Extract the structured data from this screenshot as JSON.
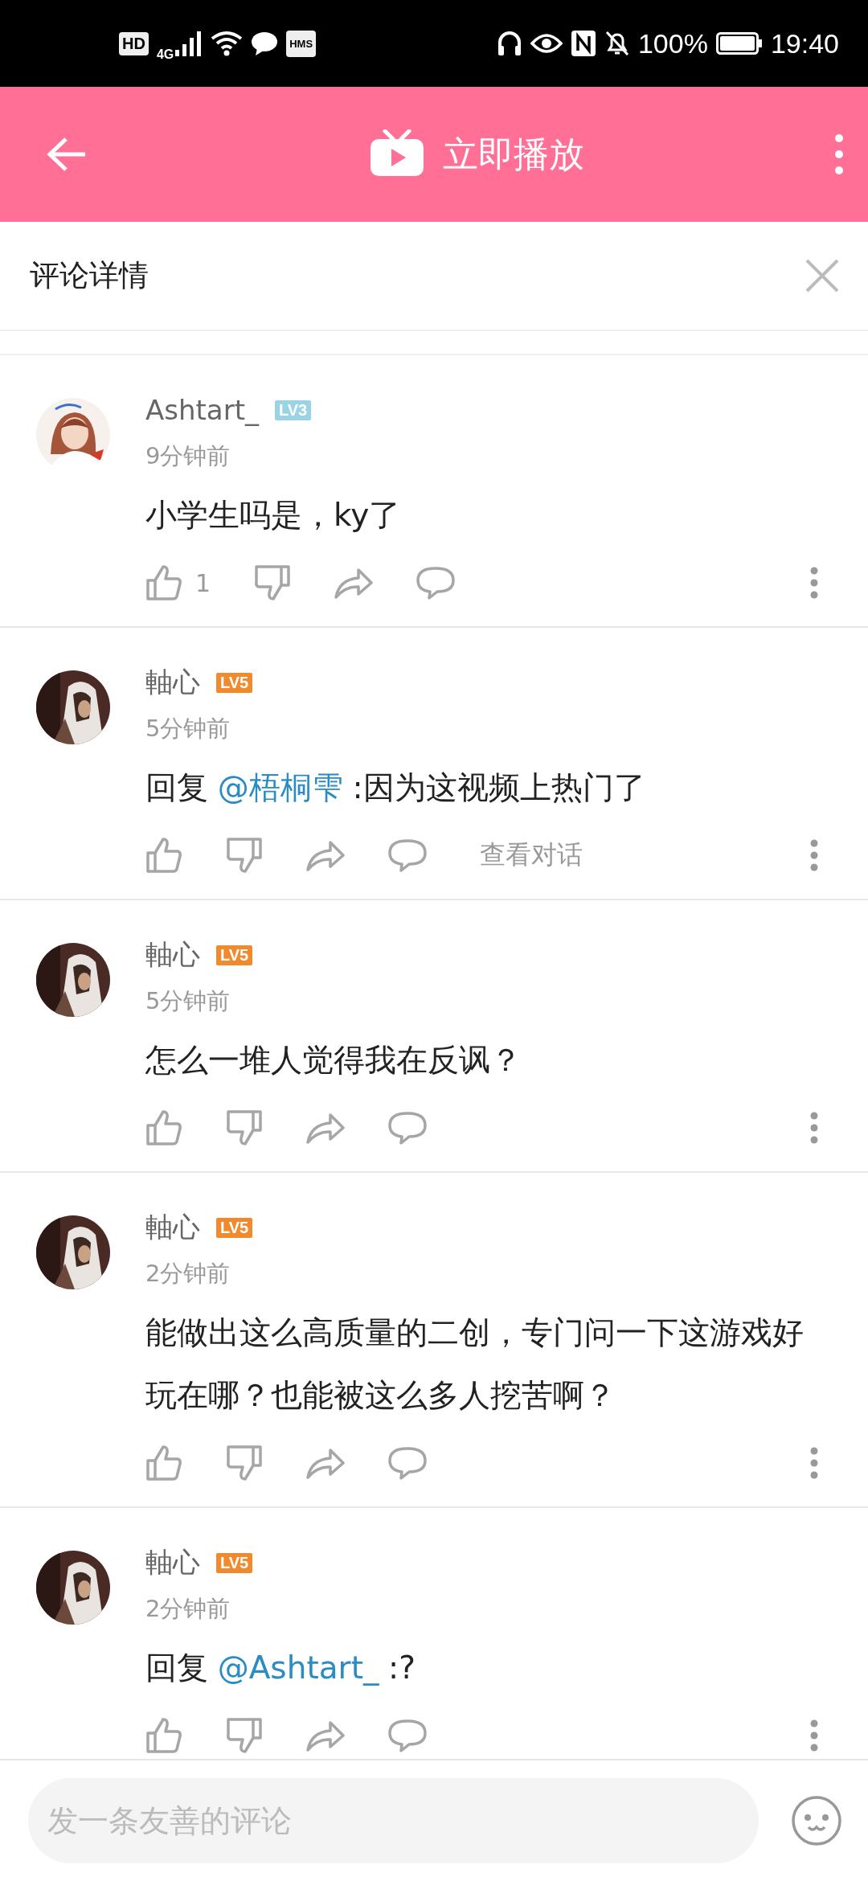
{
  "status_bar": {
    "hd": "HD",
    "network": "4G",
    "hms": "HMS",
    "battery": "100%",
    "time": "19:40"
  },
  "header": {
    "title": "立即播放"
  },
  "panel": {
    "title": "评论详情"
  },
  "comments": [
    {
      "user": "Ashtart_",
      "level": "LV3",
      "color": "#9bd3e6",
      "time": "9分钟前",
      "text": "小学生吗是，ky了",
      "likes": "1"
    },
    {
      "user": "軸心",
      "level": "LV5",
      "color": "#f08a2c",
      "time": "5分钟前",
      "prefix": "回复",
      "mention": "@梧桐雫",
      "text": ":因为这视频上热门了",
      "dialog": "查看对话"
    },
    {
      "user": "軸心",
      "level": "LV5",
      "color": "#f08a2c",
      "time": "5分钟前",
      "text": "怎么一堆人觉得我在反讽？"
    },
    {
      "user": "軸心",
      "level": "LV5",
      "color": "#f08a2c",
      "time": "2分钟前",
      "text": "能做出这么高质量的二创，专门问一下这游戏好玩在哪？也能被这么多人挖苦啊？"
    },
    {
      "user": "軸心",
      "level": "LV5",
      "color": "#f08a2c",
      "time": "2分钟前",
      "prefix": "回复",
      "mention": "@Ashtart_",
      "text": ":?"
    }
  ],
  "composer": {
    "placeholder": "发一条友善的评论"
  }
}
